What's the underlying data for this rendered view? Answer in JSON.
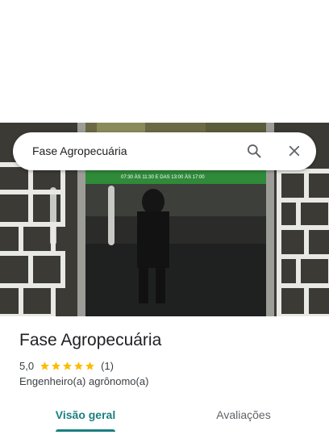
{
  "search": {
    "query": "Fase Agropecuária"
  },
  "icons": {
    "search": "search-icon",
    "close": "close-icon",
    "star": "star-icon"
  },
  "place": {
    "name": "Fase Agropecuária",
    "rating": "5,0",
    "stars": 5,
    "review_count": "(1)",
    "category": "Engenheiro(a) agrônomo(a)"
  },
  "photo": {
    "sign_text": "07:30 ÀS 11:30 E DAS 13:00 ÀS 17:00"
  },
  "tabs": [
    {
      "label": "Visão geral",
      "active": true
    },
    {
      "label": "Avaliações",
      "active": false
    }
  ],
  "colors": {
    "accent": "#1a7f80",
    "star": "#fbbc04",
    "text_primary": "#202124",
    "text_secondary": "#3c4043"
  }
}
